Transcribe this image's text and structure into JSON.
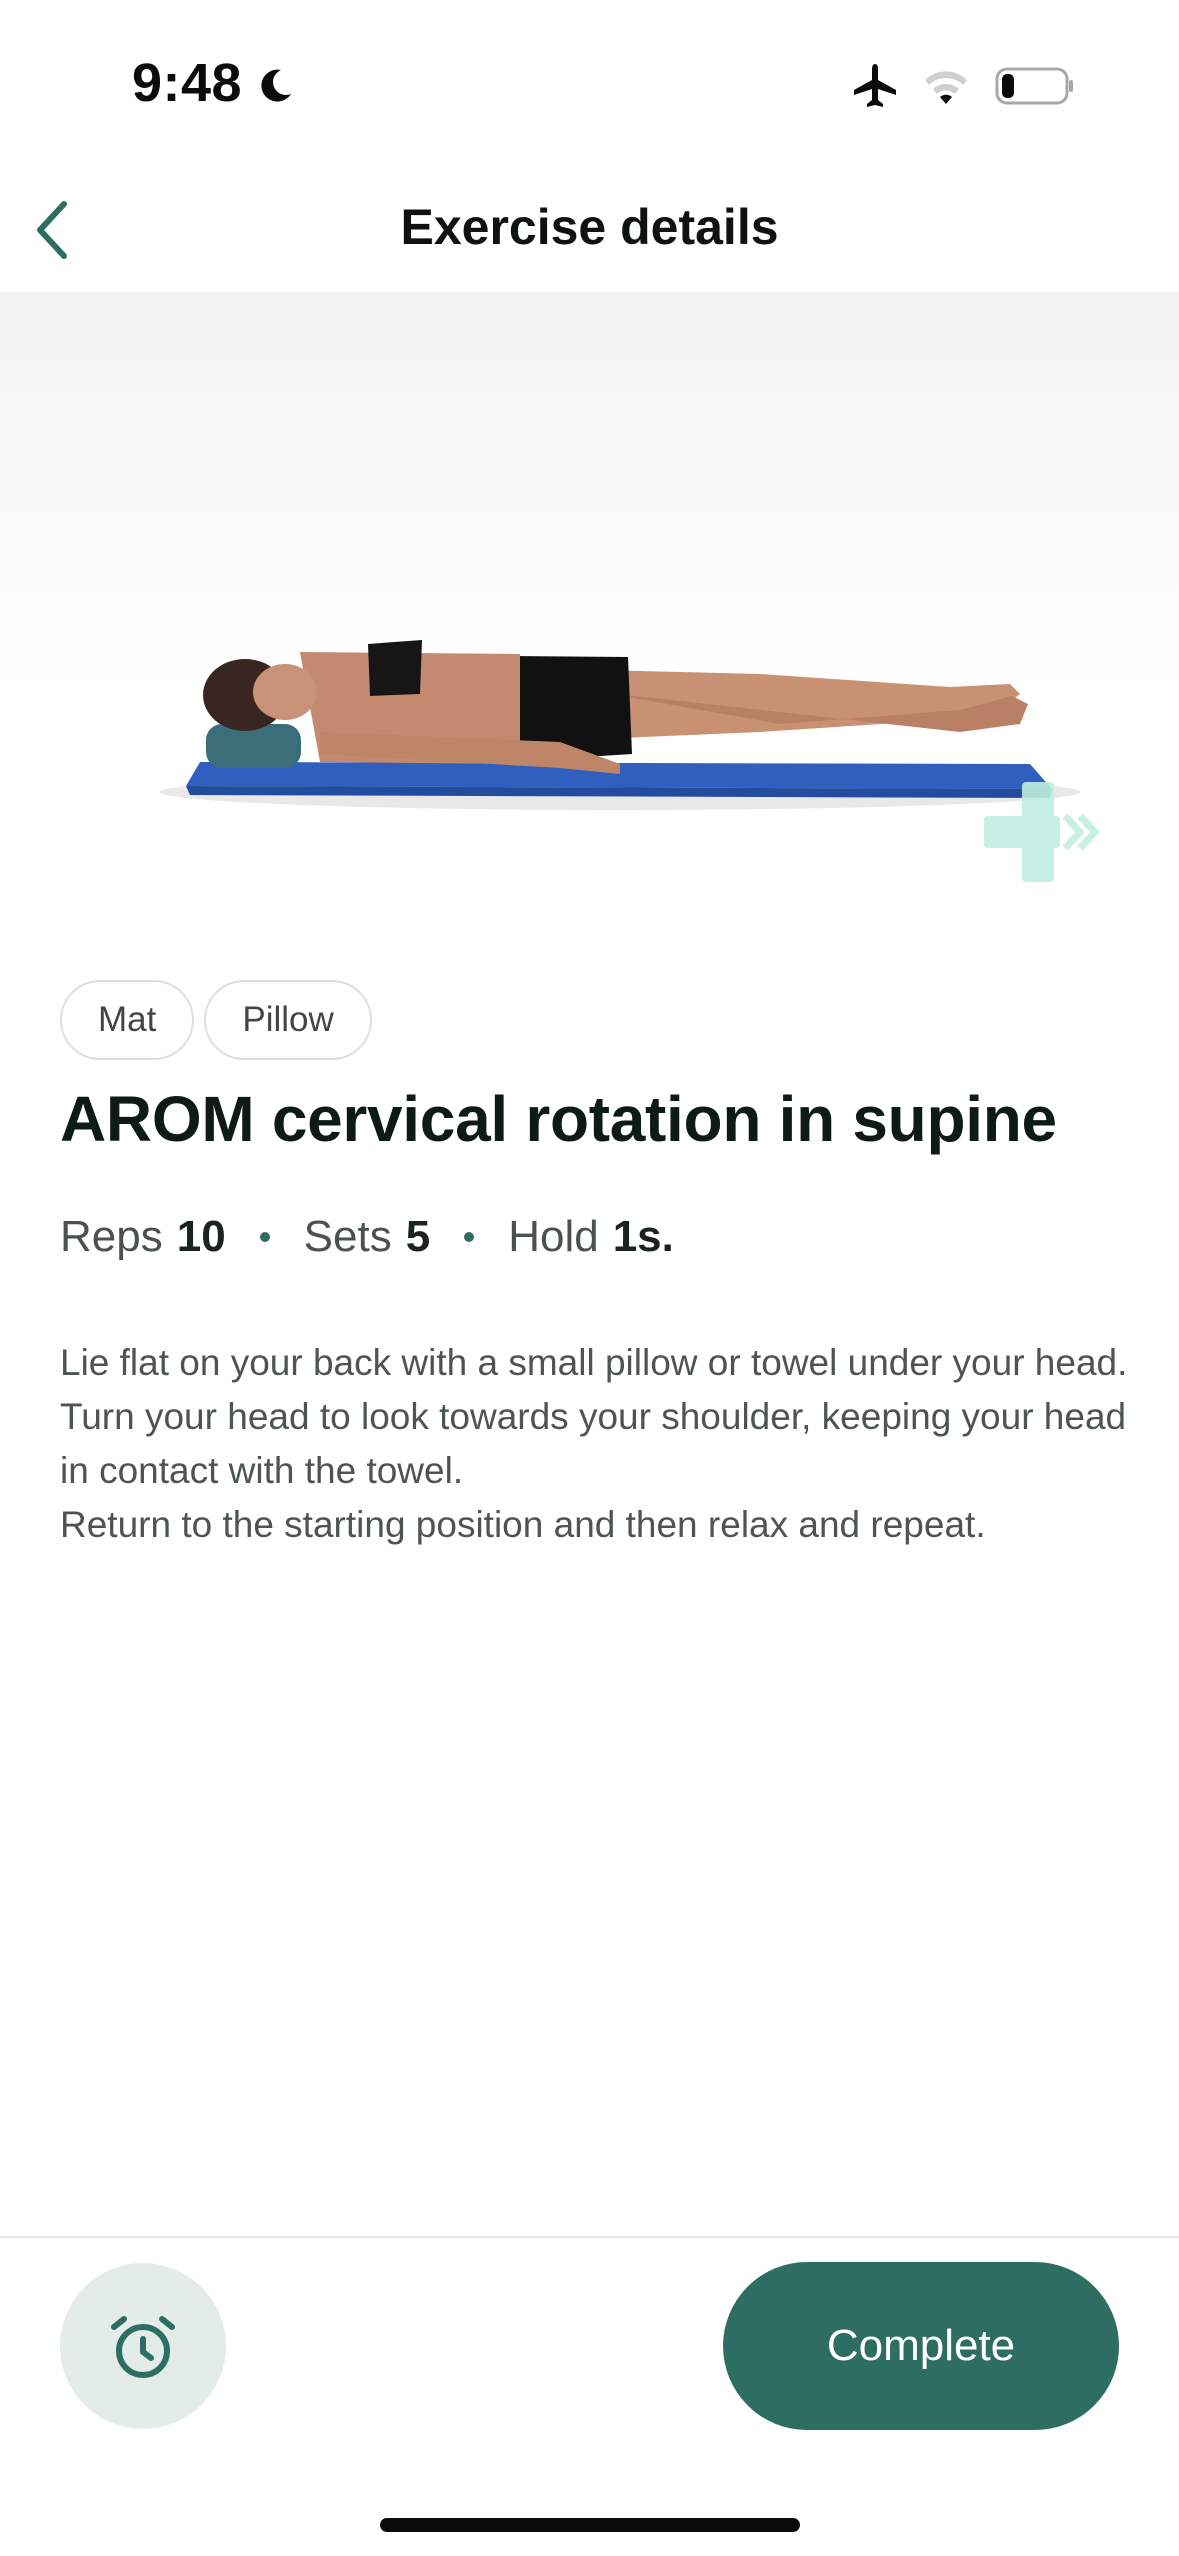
{
  "status_bar": {
    "time": "9:48",
    "icons": [
      "moon-icon",
      "airplane-icon",
      "wifi-icon",
      "battery-icon"
    ],
    "battery_level": 0.15
  },
  "header": {
    "title": "Exercise details",
    "back_icon": "chevron-left-icon"
  },
  "hero": {
    "image": "person-lying-supine-on-blue-mat",
    "watermark": "plus-arrow-logo"
  },
  "tags": [
    "Mat",
    "Pillow"
  ],
  "exercise": {
    "title": "AROM cervical rotation in supine",
    "params": [
      {
        "label": "Reps",
        "value": "10"
      },
      {
        "label": "Sets",
        "value": "5"
      },
      {
        "label": "Hold",
        "value": "1s."
      }
    ],
    "description": [
      "Lie flat on your back with a small pillow or towel under your head.",
      "Turn your head to look towards your shoulder, keeping your head in contact with the towel.",
      "Return to the starting position and then relax and repeat."
    ]
  },
  "footer": {
    "timer_icon": "stopwatch-icon",
    "complete_label": "Complete"
  },
  "colors": {
    "accent": "#2e6e62",
    "timer_bg": "#e4ecea",
    "mat_blue": "#2f5fbf",
    "watermark": "#bfeee0"
  }
}
